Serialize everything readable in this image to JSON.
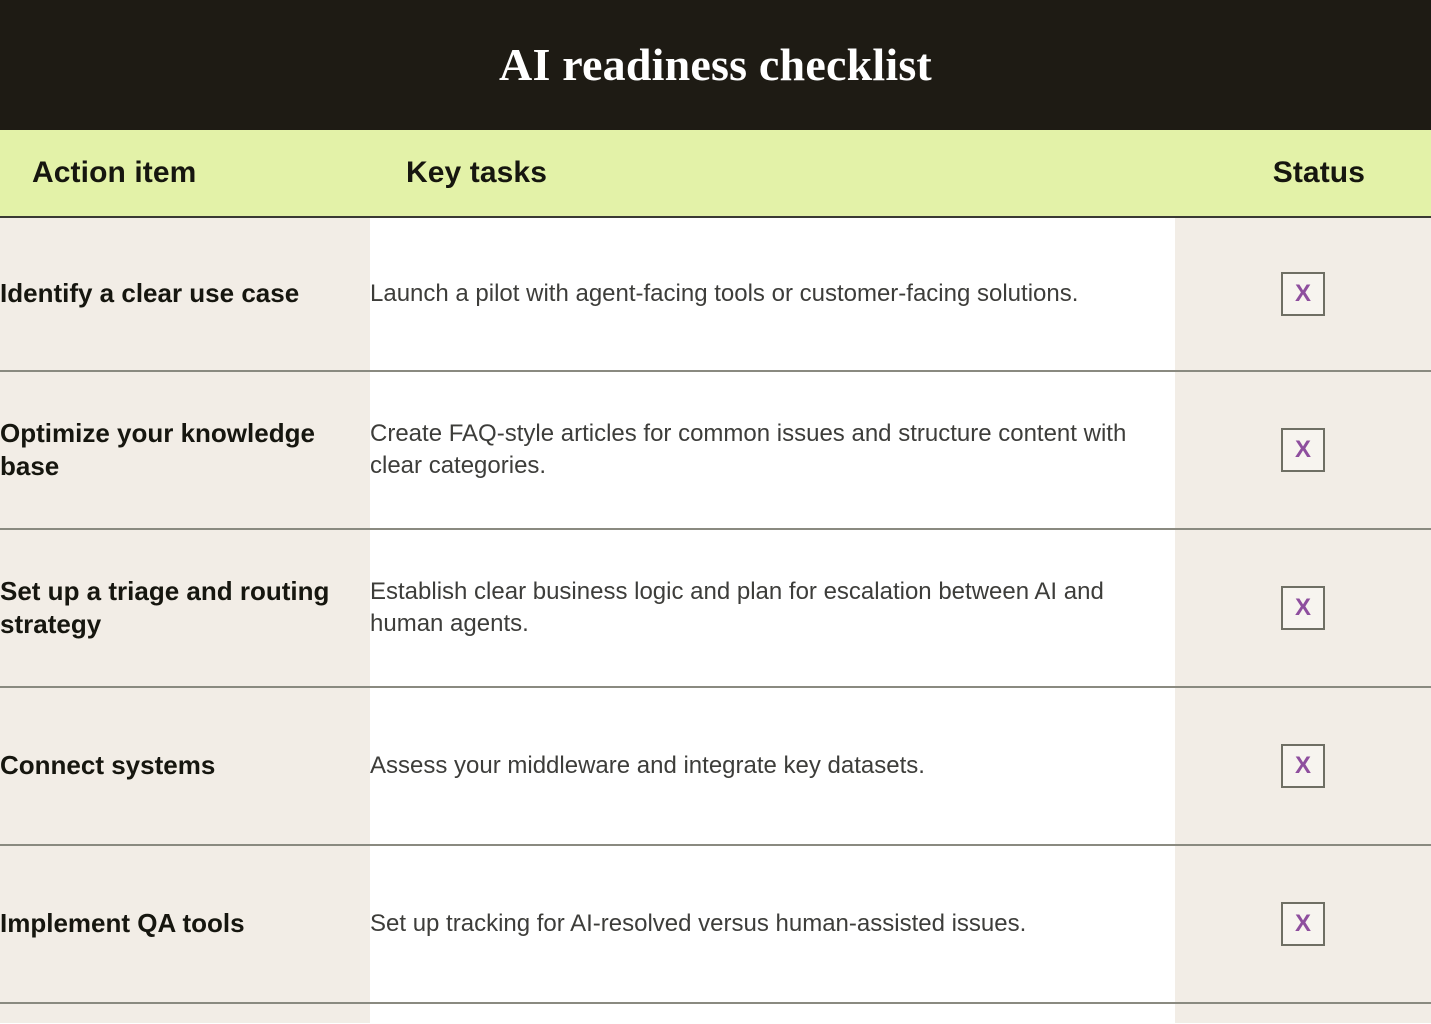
{
  "banner": {
    "title": "AI readiness checklist",
    "background_color": "#1e1b14",
    "text_color": "#ffffff"
  },
  "table": {
    "header_background_color": "#e3f2a8",
    "action_column_background_color": "#f2ede6",
    "tasks_column_background_color": "#ffffff",
    "status_column_background_color": "#f2ede6",
    "divider_color": "#8a8a80",
    "status_mark_color": "#8e4e9e",
    "columns": [
      {
        "key": "action",
        "label": "Action item"
      },
      {
        "key": "tasks",
        "label": "Key tasks"
      },
      {
        "key": "status",
        "label": "Status"
      }
    ],
    "rows": [
      {
        "action": "Identify a clear use case",
        "tasks": "Launch a pilot with agent-facing tools or customer-facing solutions.",
        "status": "X"
      },
      {
        "action": "Optimize your knowledge base",
        "tasks": "Create FAQ-style articles for common issues and structure content with clear categories.",
        "status": "X"
      },
      {
        "action": "Set up a triage and routing strategy",
        "tasks": "Establish clear business logic and plan for escalation between AI and human agents.",
        "status": "X"
      },
      {
        "action": "Connect systems",
        "tasks": "Assess your middleware and integrate key datasets.",
        "status": "X"
      },
      {
        "action": "Implement QA tools",
        "tasks": "Set up tracking for AI-resolved versus human-assisted issues.",
        "status": "X"
      }
    ]
  }
}
